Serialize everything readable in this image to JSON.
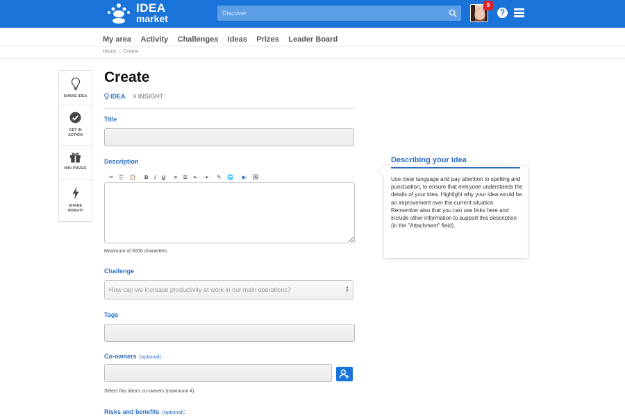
{
  "header": {
    "logo_line1": "IDEA",
    "logo_line2": "market",
    "search_placeholder": "Discover",
    "notification_count": "9",
    "help_symbol": "?"
  },
  "nav": {
    "items": [
      "My area",
      "Activity",
      "Challenges",
      "Ideas",
      "Prizes",
      "Leader Board"
    ]
  },
  "breadcrumb": [
    "Home",
    "Create"
  ],
  "breadcrumb_separator": "›",
  "steps": [
    {
      "label_line1": "SHARE IDEA",
      "label_line2": "",
      "icon": "lightbulb-icon"
    },
    {
      "label_line1": "GET IN",
      "label_line2": "ACTION",
      "icon": "check-circle-icon"
    },
    {
      "label_line1": "WIN PRIZES",
      "label_line2": "",
      "icon": "gift-icon"
    },
    {
      "label_line1": "SHARE",
      "label_line2": "INSIGHT",
      "icon": "bolt-icon"
    }
  ],
  "page": {
    "title": "Create",
    "type_tabs": {
      "idea": "IDEA",
      "insight": "INSIGHT"
    }
  },
  "form": {
    "title_label": "Title",
    "description_label": "Description",
    "description_hint": "Maximum of 3000 characters.",
    "editor_buttons": [
      "✂",
      "⎘",
      "📋",
      "B",
      "I",
      "U",
      "≡",
      "☰",
      "⇤",
      "⇥",
      "✎",
      "🌐",
      "▶",
      "🖼"
    ],
    "challenge_label": "Challenge",
    "challenge_selected": "How can we increase productivity at work in our main operations?",
    "tags_label": "Tags",
    "coowners_label": "Co-owners",
    "coowners_optional": "(optional)",
    "coowners_hint": "Select this idea's co-owners (maximum 4).",
    "risks_label": "Risks and benefits",
    "risks_optional": "(optional)",
    "risks_colon": ":"
  },
  "help_panel": {
    "title": "Describing your idea",
    "text": "Use clear language and pay attention to spelling and punctuation, to ensure that everyone understands the details of your idea. Highlight why your idea would be an improvement over the current situation. Remember also that you can use links here and include other information to support this description (in the \"Attachment\" field)."
  },
  "colors": {
    "header_blue": "#1a73d8",
    "label_blue": "#2a6fc4",
    "badge_red": "#d9222a"
  }
}
